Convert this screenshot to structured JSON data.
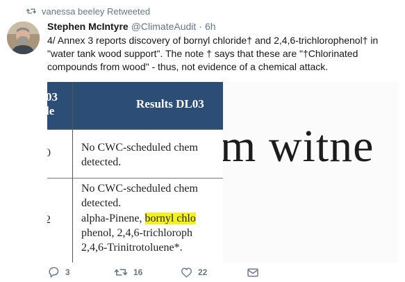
{
  "retweet_line": {
    "text": "vanessa beeley Retweeted",
    "icon": "retweet-icon"
  },
  "author": {
    "name": "Stephen McIntyre",
    "handle": "@ClimateAudit",
    "separator": "·",
    "time": "6h"
  },
  "tweet_text": "4/ Annex 3 reports discovery of bornyl chloride† and 2,4,6-trichlorophenol† in \"water tank wood support\". The note † says that these are \"†Chlorinated compounds from wood\" - thus, not evidence of a chemical attack.",
  "media": {
    "left": {
      "header_left_top": "03",
      "header_left_bottom": "le",
      "header_right": "Results DL03",
      "row1_num": "0",
      "row1_line1": "No CWC-scheduled chem",
      "row1_line2": "detected.",
      "row2_num": "2",
      "row2_line1": "No CWC-scheduled chem",
      "row2_line2": "detected.",
      "row2_line3a": "alpha-Pinene, ",
      "row2_line3b": "bornyl chlo",
      "row2_line4": "phenol, 2,4,6-trichloroph",
      "row2_line5": "2,4,6-Trinitrotoluene*."
    },
    "right": {
      "zoom_text": "m witne"
    }
  },
  "actions": {
    "reply": {
      "icon": "reply-icon",
      "count": "3"
    },
    "retweet": {
      "icon": "retweet-icon",
      "count": "16"
    },
    "like": {
      "icon": "heart-icon",
      "count": "22"
    },
    "message": {
      "icon": "envelope-icon"
    }
  },
  "colors": {
    "accent_gray": "#657786",
    "table_header": "#2c4d75",
    "highlight": "#f3f21a"
  }
}
